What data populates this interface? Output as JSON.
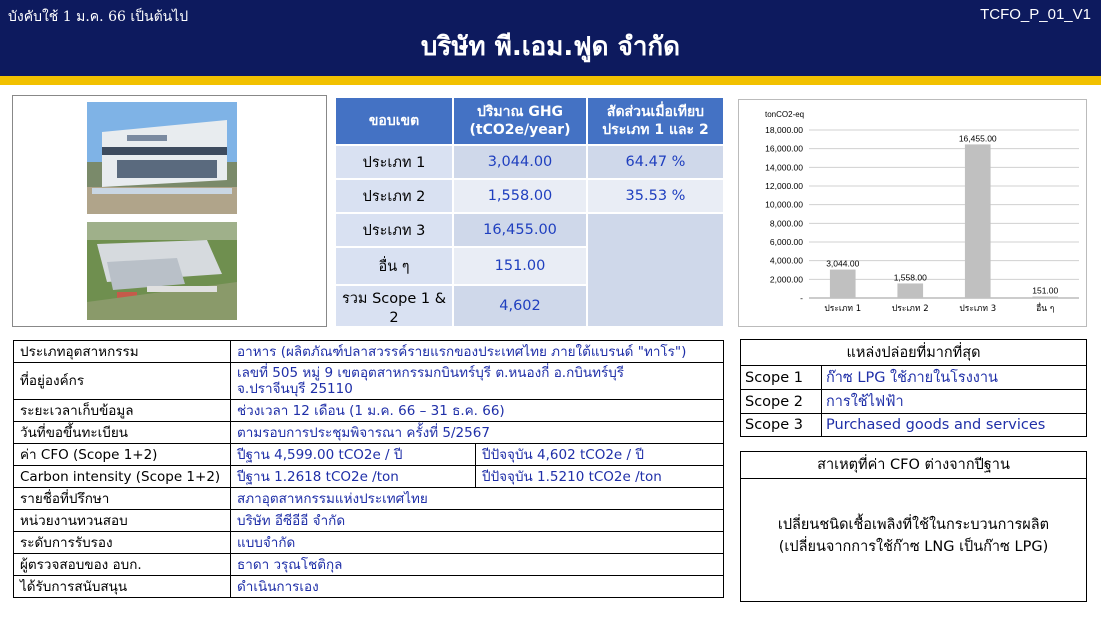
{
  "header": {
    "effective": "บังคับใช้ 1 ม.ค. 66 เป็นต้นไป",
    "doc_code": "TCFO_P_01_V1",
    "company": "บริษัท พี.เอม.ฟูด จำกัด"
  },
  "ghg_table": {
    "headers": [
      "ขอบเขต",
      "ปริมาณ GHG (tCO2e/year)",
      "สัดส่วนเมื่อเทียบ ประเภท 1 และ 2"
    ],
    "header_lines": [
      [
        "ขอบเขต"
      ],
      [
        "ปริมาณ GHG",
        "(tCO2e/year)"
      ],
      [
        "สัดส่วนเมื่อเทียบ",
        "ประเภท 1 และ 2"
      ]
    ],
    "rows": [
      {
        "scope": "ประเภท 1",
        "ghg": "3,044.00",
        "ratio": "64.47 %"
      },
      {
        "scope": "ประเภท 2",
        "ghg": "1,558.00",
        "ratio": "35.53 %"
      },
      {
        "scope": "ประเภท 3",
        "ghg": "16,455.00",
        "ratio": ""
      },
      {
        "scope": "อื่น ๆ",
        "ghg": "151.00",
        "ratio": ""
      },
      {
        "scope": "รวม Scope 1 & 2",
        "ghg": "4,602",
        "ratio": ""
      }
    ]
  },
  "chart_data": {
    "type": "bar",
    "ylabel": "tonCO2-eq",
    "categories": [
      "ประเภท 1",
      "ประเภท 2",
      "ประเภท 3",
      "อื่น ๆ"
    ],
    "values": [
      3044,
      1558,
      16455,
      151
    ],
    "data_labels": [
      "3,044.00",
      "1,558.00",
      "16,455.00",
      "151.00"
    ],
    "ylim": [
      0,
      18000
    ],
    "yticks": [
      0,
      2000,
      4000,
      6000,
      8000,
      10000,
      12000,
      14000,
      16000,
      18000
    ],
    "ytick_labels": [
      "-",
      "2,000.00",
      "4,000.00",
      "6,000.00",
      "8,000.00",
      "10,000.00",
      "12,000.00",
      "14,000.00",
      "16,000.00",
      "18,000.00"
    ],
    "grid": true,
    "bar_color": "#c0c0c0"
  },
  "info": [
    {
      "key": "ประเภทอุตสาหกรรม",
      "value": "อาหาร (ผลิตภัณฑ์ปลาสวรรค์รายแรกของประเทศไทย ภายใต้แบรนด์ \"ทาโร\")"
    },
    {
      "key": "ที่อยู่องค์กร",
      "value": "เลขที่ 505 หมู่ 9 เขตอุตสาหกรรมกบินทร์บุรี ต.หนองกี่ อ.กบินทร์บุรี",
      "value2": "จ.ปราจีนบุรี 25110"
    },
    {
      "key": "ระยะเวลาเก็บข้อมูล",
      "value": "ช่วงเวลา 12 เดือน (1 ม.ค. 66 – 31 ธ.ค. 66)"
    },
    {
      "key": "วันที่ขอขึ้นทะเบียน",
      "value": "ตามรอบการประชุมพิจารณา ครั้งที่ 5/2567"
    },
    {
      "key": "ค่า CFO (Scope 1+2)",
      "value": "ปีฐาน  4,599.00 tCO2e / ปี",
      "value2": "ปีปัจจุบัน 4,602 tCO2e / ปี"
    },
    {
      "key": "Carbon intensity (Scope 1+2)",
      "value": "ปีฐาน  1.2618 tCO2e /ton",
      "value2": "ปีปัจจุบัน  1.5210 tCO2e /ton"
    },
    {
      "key": "รายชื่อที่ปรึกษา",
      "value": "สภาอุตสาหกรรมแห่งประเทศไทย"
    },
    {
      "key": "หน่วยงานทวนสอบ",
      "value": "บริษัท อีซีอีอี จำกัด"
    },
    {
      "key": "ระดับการรับรอง",
      "value": "แบบจำกัด"
    },
    {
      "key": "ผู้ตรวจสอบของ อบก.",
      "value": "ธาดา วรุณโชติกุล"
    },
    {
      "key": "ได้รับการสนับสนุน",
      "value": "ดำเนินการเอง"
    }
  ],
  "emission_sources": {
    "title": "แหล่งปล่อยที่มากที่สุด",
    "items": [
      {
        "scope": "Scope 1",
        "source": "ก๊าซ LPG ใช้ภายในโรงงาน"
      },
      {
        "scope": "Scope 2",
        "source": "การใช้ไฟฟ้า"
      },
      {
        "scope": "Scope 3",
        "source": "Purchased goods and services"
      }
    ]
  },
  "reason": {
    "title": "สาเหตุที่ค่า CFO ต่างจากปีฐาน",
    "line1": "เปลี่ยนชนิดเชื้อเพลิงที่ใช้ในกระบวนการผลิต",
    "line2": "(เปลี่ยนจากการใช้ก๊าซ LNG เป็นก๊าซ LPG)"
  }
}
